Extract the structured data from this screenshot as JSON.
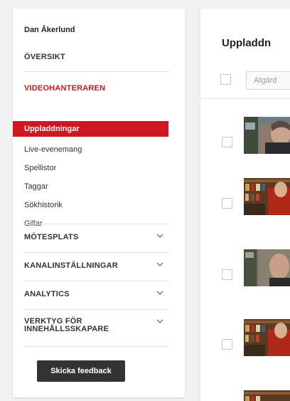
{
  "sidebar": {
    "user_name": "Dan Åkerlund",
    "overview": "ÖVERSIKT",
    "video_manager": "VIDEOHANTERAREN",
    "items": [
      {
        "label": "Uppladdningar",
        "active": true
      },
      {
        "label": "Live-evenemang"
      },
      {
        "label": "Spellistor"
      },
      {
        "label": "Taggar"
      },
      {
        "label": "Sökhistorik"
      },
      {
        "label": "Gillar"
      }
    ],
    "sections": [
      {
        "label": "MÖTESPLATS",
        "icon": "chevron-down-icon"
      },
      {
        "label": "KANALINSTÄLLNINGAR",
        "icon": "chevron-down-icon"
      },
      {
        "label": "ANALYTICS",
        "icon": "chevron-down-icon"
      },
      {
        "label_line1": "VERKTYG FÖR",
        "label_line2": "INNEHÅLLSSKAPARE",
        "icon": "chevron-down-icon"
      }
    ],
    "feedback_button": "Skicka feedback"
  },
  "main": {
    "title": "Uppladdn",
    "actions_label": "Atgärd"
  },
  "colors": {
    "accent": "#cc181e",
    "button_dark": "#333333",
    "background": "#f1f1f1"
  }
}
